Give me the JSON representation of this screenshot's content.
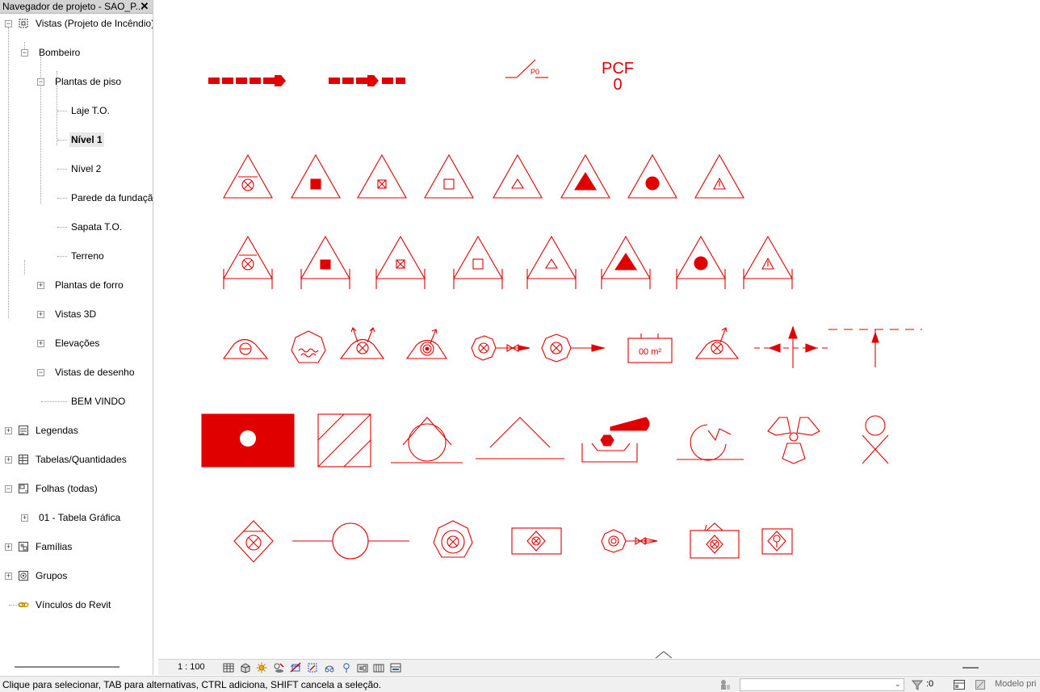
{
  "browser": {
    "title": "Navegador de projeto - SAO_P...",
    "close_glyph": "✕",
    "tree": [
      {
        "label": "Vistas (Projeto de Incêndio)",
        "icon": "views-icon",
        "expanded": true
      },
      {
        "label": "Bombeiro",
        "expanded": true
      },
      {
        "label": "Plantas de piso",
        "expanded": true
      },
      {
        "label": "Laje T.O."
      },
      {
        "label": "Nível 1",
        "selected": true
      },
      {
        "label": "Nível 2"
      },
      {
        "label": "Parede da fundação"
      },
      {
        "label": "Sapata T.O."
      },
      {
        "label": "Terreno"
      },
      {
        "label": "Plantas de forro",
        "expanded": false
      },
      {
        "label": "Vistas 3D",
        "expanded": false
      },
      {
        "label": "Elevações",
        "expanded": false
      },
      {
        "label": "Vistas de desenho",
        "expanded": true
      },
      {
        "label": "BEM VINDO"
      },
      {
        "label": "Legendas",
        "icon": "legends-icon",
        "expanded": false
      },
      {
        "label": "Tabelas/Quantidades",
        "icon": "schedules-icon",
        "expanded": false
      },
      {
        "label": "Folhas (todas)",
        "icon": "sheets-icon",
        "expanded": true
      },
      {
        "label": "01 - Tabela Gráfica",
        "expanded": false
      },
      {
        "label": "Famílias",
        "icon": "families-icon",
        "expanded": false
      },
      {
        "label": "Grupos",
        "icon": "groups-icon",
        "expanded": false
      },
      {
        "label": "Vínculos do Revit",
        "icon": "revit-links-icon"
      }
    ]
  },
  "canvas": {
    "pcf_label": "PCF",
    "pcf_value": "0",
    "p0_label": "P0",
    "area_label": "00 m²",
    "symbol_color": "#e00000"
  },
  "view_control_bar": {
    "scale": "1 : 100"
  },
  "status_bar": {
    "message": "Clique para selecionar, TAB para alternativas, CTRL adiciona, SHIFT cancela a seleção.",
    "selection_count": ":0",
    "active_model": "Modelo pri"
  }
}
